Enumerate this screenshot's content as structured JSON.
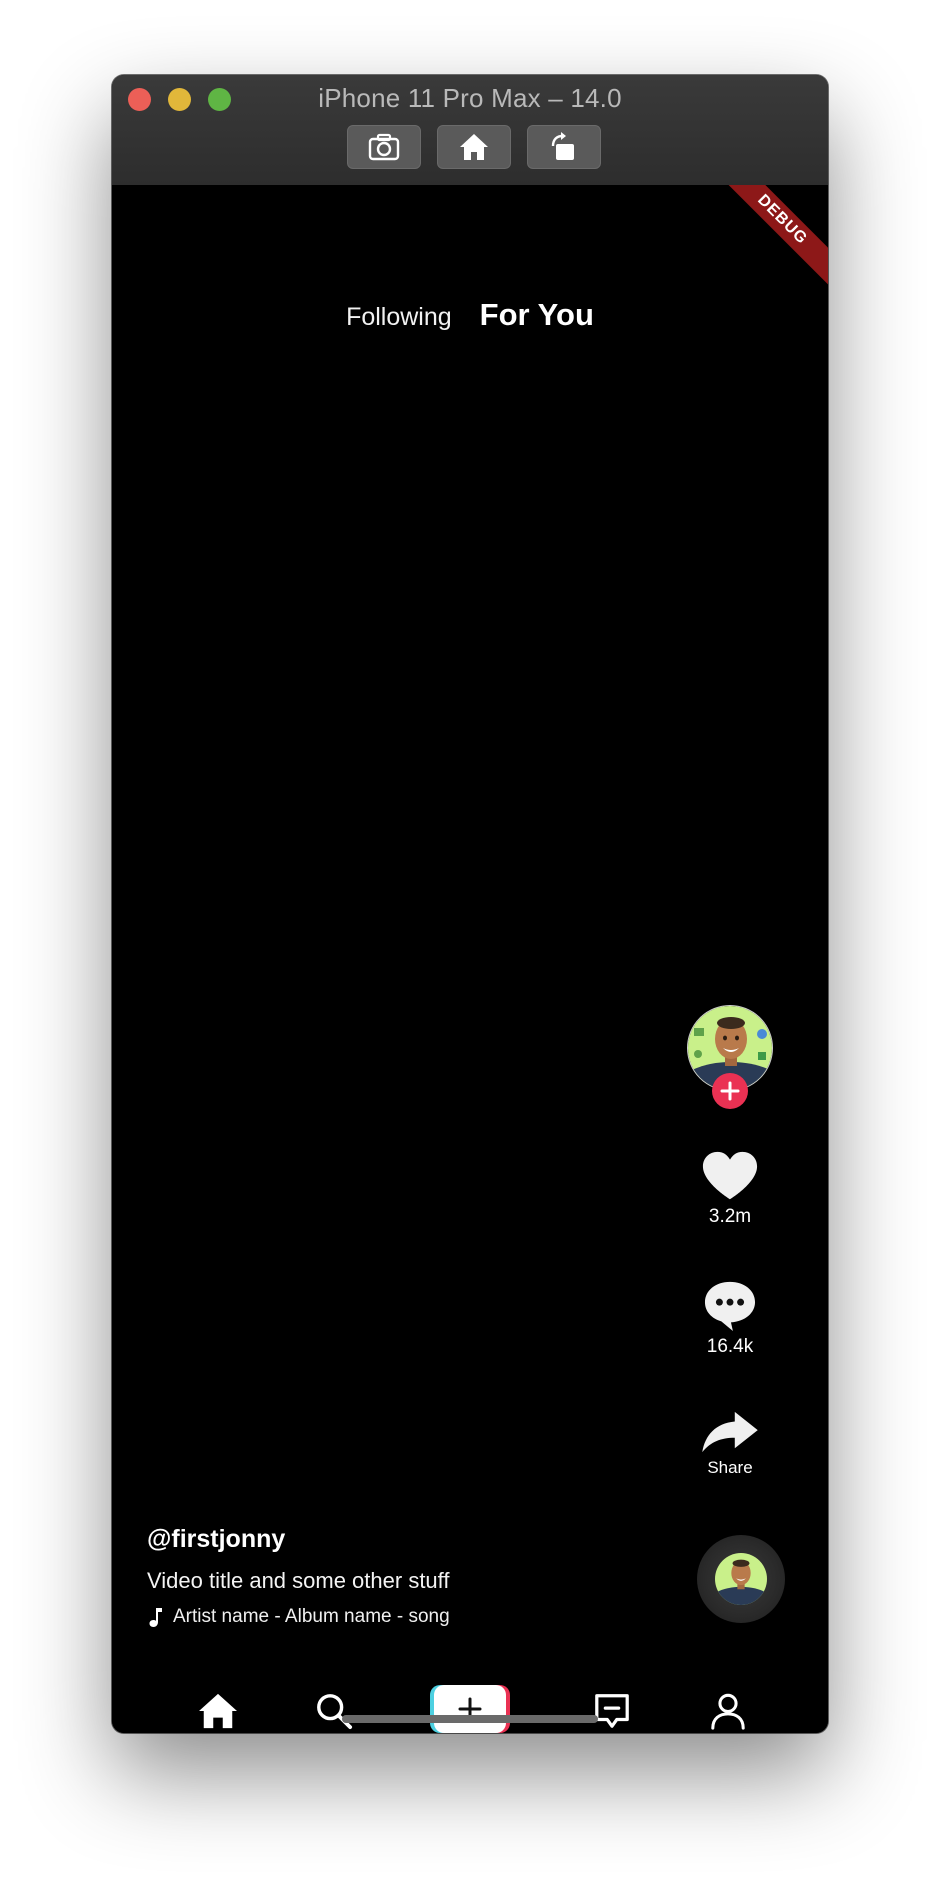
{
  "window": {
    "title": "iPhone 11 Pro Max – 14.0",
    "toolbar": [
      "screenshot-button",
      "home-button",
      "rotate-button"
    ]
  },
  "debug_banner": "DEBUG",
  "feed_tabs": {
    "following": "Following",
    "for_you": "For You",
    "active": "For You"
  },
  "actions": {
    "likes": "3.2m",
    "comments": "16.4k",
    "share": "Share"
  },
  "post": {
    "username": "@firstjonny",
    "title": "Video title and some other stuff",
    "song": "Artist name - Album name - song"
  },
  "nav": [
    "home-icon",
    "search-icon",
    "create-button",
    "inbox-icon",
    "profile-icon"
  ],
  "colors": {
    "accent_red": "#ea3153",
    "accent_cyan": "#4dd0e1",
    "debug_ribbon": "#8d1818",
    "background": "#000000"
  }
}
